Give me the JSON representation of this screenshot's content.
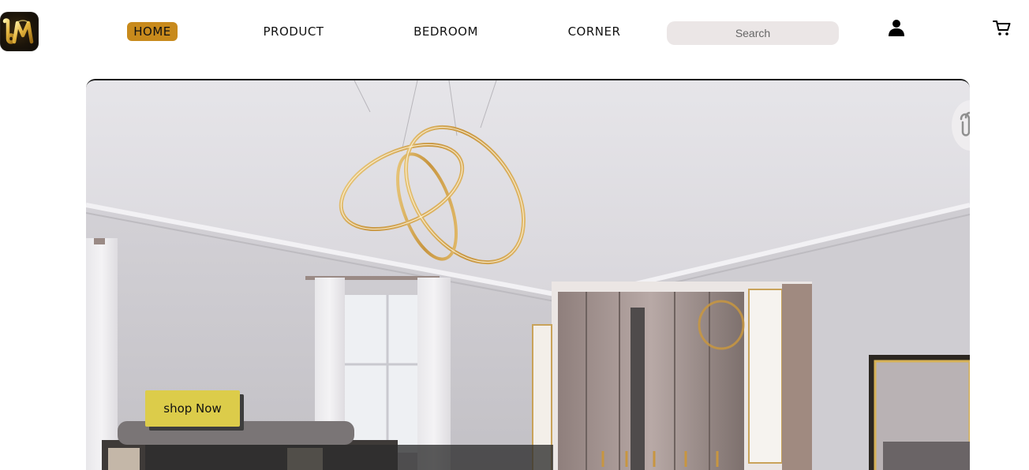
{
  "header": {
    "logo_text": "bM",
    "nav": [
      {
        "label": "HOME",
        "active": true
      },
      {
        "label": "PRODUCT",
        "active": false
      },
      {
        "label": "BEDROOM",
        "active": false
      },
      {
        "label": "CORNER",
        "active": false
      }
    ],
    "search": {
      "placeholder": "Search",
      "value": ""
    },
    "icons": {
      "user": "user-icon",
      "cart": "cart-icon"
    }
  },
  "hero": {
    "image": "bedroom-interior-image",
    "cta_label": "shop Now"
  },
  "colors": {
    "accent_gold": "#c88a1c",
    "cta_yellow": "#dccc4a",
    "search_bg": "#ebe6e6",
    "cta_shadow": "#3d3d3d"
  }
}
